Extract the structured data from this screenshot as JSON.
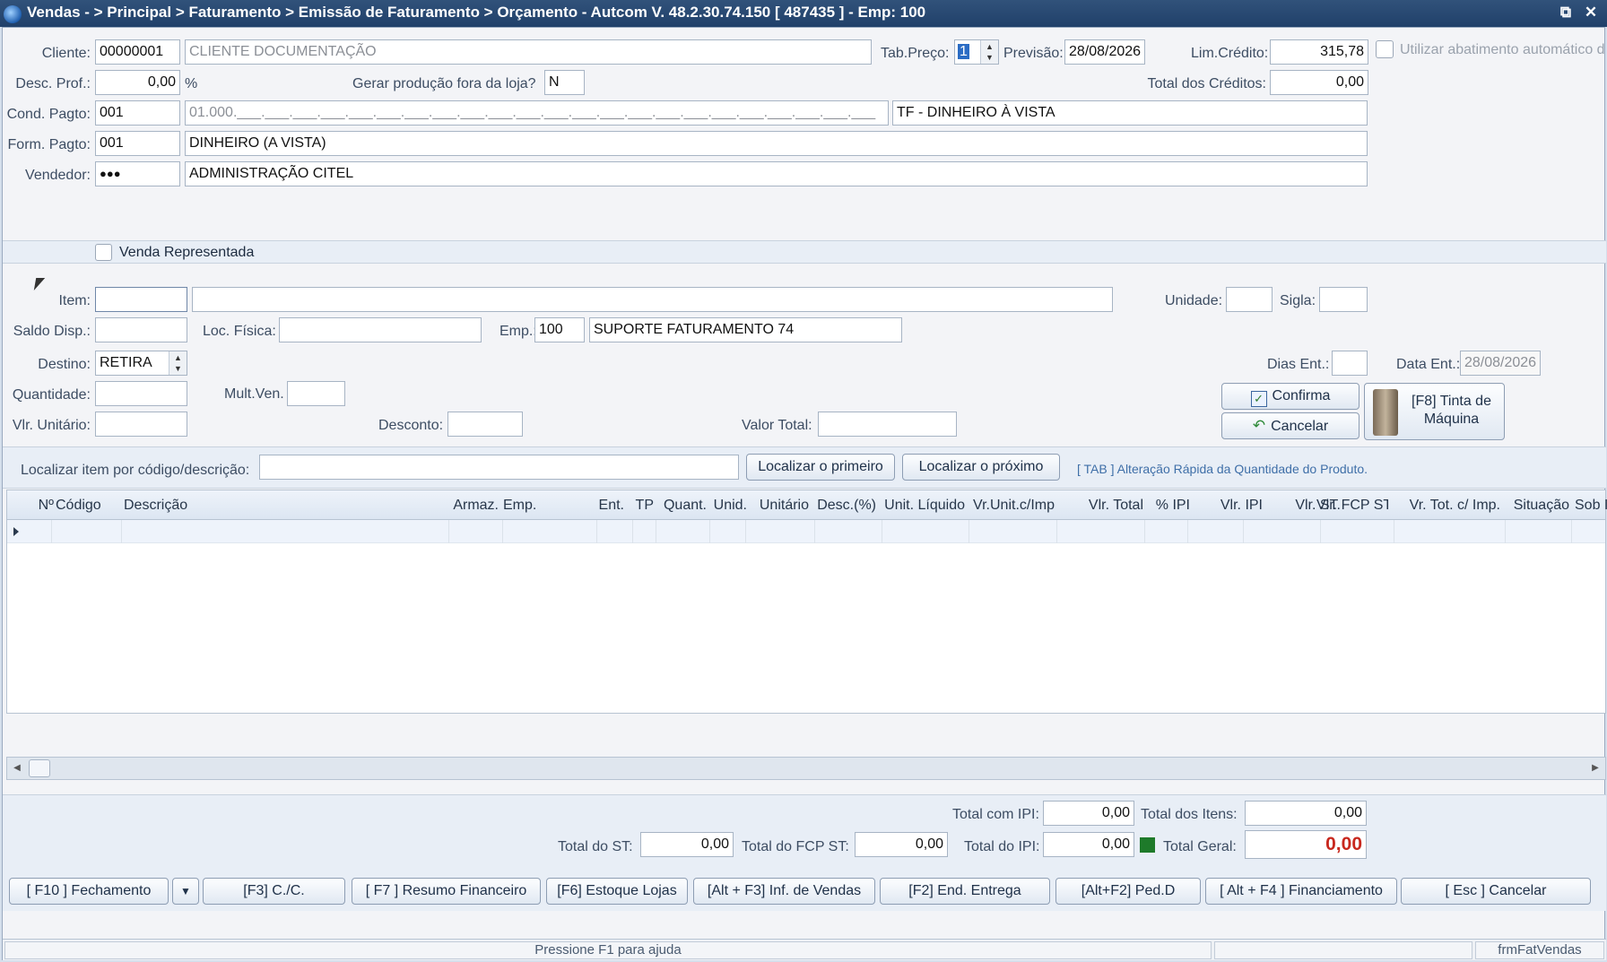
{
  "window": {
    "title": "Vendas -  > Principal > Faturamento > Emissão de Faturamento > Orçamento   -   Autcom V. 48.2.30.74.150 [ 487435 ] - Emp: 100",
    "restore_icon": "restore-icon",
    "close_icon": "close-icon"
  },
  "header": {
    "cliente_label": "Cliente:",
    "cliente_code": "00000001",
    "cliente_name": "CLIENTE DOCUMENTAÇÃO",
    "tab_preco_label": "Tab.Preço:",
    "tab_preco_value": "1",
    "previsao_label": "Previsão:",
    "previsao_value": "28/08/2026",
    "lim_credito_label": "Lim.Crédito:",
    "lim_credito_value": "315,78",
    "abatimento_label": "Utilizar abatimento automático d",
    "desc_prof_label": "Desc. Prof.:",
    "desc_prof_value": "0,00",
    "percent_sign": "%",
    "gerar_producao_label": "Gerar produção fora da loja?",
    "gerar_producao_value": "N",
    "total_creditos_label": "Total dos Créditos:",
    "total_creditos_value": "0,00",
    "cond_pagto_label": "Cond. Pagto:",
    "cond_pagto_code": "001",
    "cond_pagto_mask": "01.000.___.___.___.___.___.___.___.___.___.___.___.___.___.___.___.___.___.___.___.___.___.___.___",
    "cond_pagto_desc": "TF - DINHEIRO À VISTA",
    "form_pagto_label": "Form. Pagto:",
    "form_pagto_code": "001",
    "form_pagto_desc": "DINHEIRO (A VISTA)",
    "vendedor_label": "Vendedor:",
    "vendedor_code": "●●●",
    "vendedor_name": "ADMINISTRAÇÃO CITEL",
    "venda_representada_label": "Venda Representada"
  },
  "item": {
    "item_label": "Item:",
    "item_value": "",
    "item_desc": "",
    "unidade_label": "Unidade:",
    "sigla_label": "Sigla:",
    "saldo_label": "Saldo Disp.:",
    "loc_fisica_label": "Loc. Física:",
    "emp_label": "Emp.:",
    "emp_code": "100",
    "emp_name": "SUPORTE FATURAMENTO 74",
    "destino_label": "Destino:",
    "destino_value": "RETIRA",
    "dias_ent_label": "Dias Ent.:",
    "data_ent_label": "Data Ent.:",
    "data_ent_value": "28/08/2026",
    "quantidade_label": "Quantidade:",
    "mult_ven_label": "Mult.Ven.",
    "vlr_unitario_label": "Vlr. Unitário:",
    "desconto_label": "Desconto:",
    "valor_total_label": "Valor Total:",
    "confirma_label": "Confirma",
    "cancelar_label": "Cancelar",
    "tinta_label_1": "[F8] Tinta de",
    "tinta_label_2": "Máquina"
  },
  "search": {
    "label": "Localizar item por código/descrição:",
    "value": "",
    "first_button": "Localizar o primeiro",
    "next_button": "Localizar o próximo",
    "hint": "[ TAB ] Alteração Rápida da Quantidade do Produto."
  },
  "grid": {
    "columns": [
      "Nº",
      "Código",
      "Descrição",
      "Armaz.",
      "Emp.",
      "Ent.",
      "TP",
      "Quant.",
      "Unid.",
      "Unitário",
      "Desc.(%)",
      "Unit. Líquido",
      "Vr.Unit.c/Imp",
      "Vlr. Total",
      "% IPI",
      "Vlr. IPI",
      "Vlr. ST.",
      "Vlr. FCP ST",
      "Vr. Tot. c/ Imp.",
      "Situação",
      "Sob I"
    ]
  },
  "totals": {
    "total_com_ipi_label": "Total com IPI:",
    "total_com_ipi_value": "0,00",
    "total_itens_label": "Total dos Itens:",
    "total_itens_value": "0,00",
    "total_st_label": "Total do ST:",
    "total_st_value": "0,00",
    "total_fcp_st_label": "Total do FCP ST:",
    "total_fcp_st_value": "0,00",
    "total_ipi_label": "Total do IPI:",
    "total_ipi_value": "0,00",
    "total_geral_label": "Total Geral:",
    "total_geral_value": "0,00",
    "status_color": "#1e7a2a"
  },
  "footer_buttons": {
    "fechamento": "[ F10 ] Fechamento",
    "cc": "[F3] C./C.",
    "resumo": "[ F7 ] Resumo Financeiro",
    "estoque": "[F6] Estoque Lojas",
    "inf_vendas": "[Alt + F3] Inf. de Vendas",
    "end_entrega": "[F2] End. Entrega",
    "ped_d": "[Alt+F2] Ped.D",
    "financiamento": "[ Alt + F4 ] Financiamento",
    "cancelar": "[ Esc ] Cancelar"
  },
  "status": {
    "help": "Pressione F1 para ajuda",
    "form_name": "frmFatVendas"
  }
}
